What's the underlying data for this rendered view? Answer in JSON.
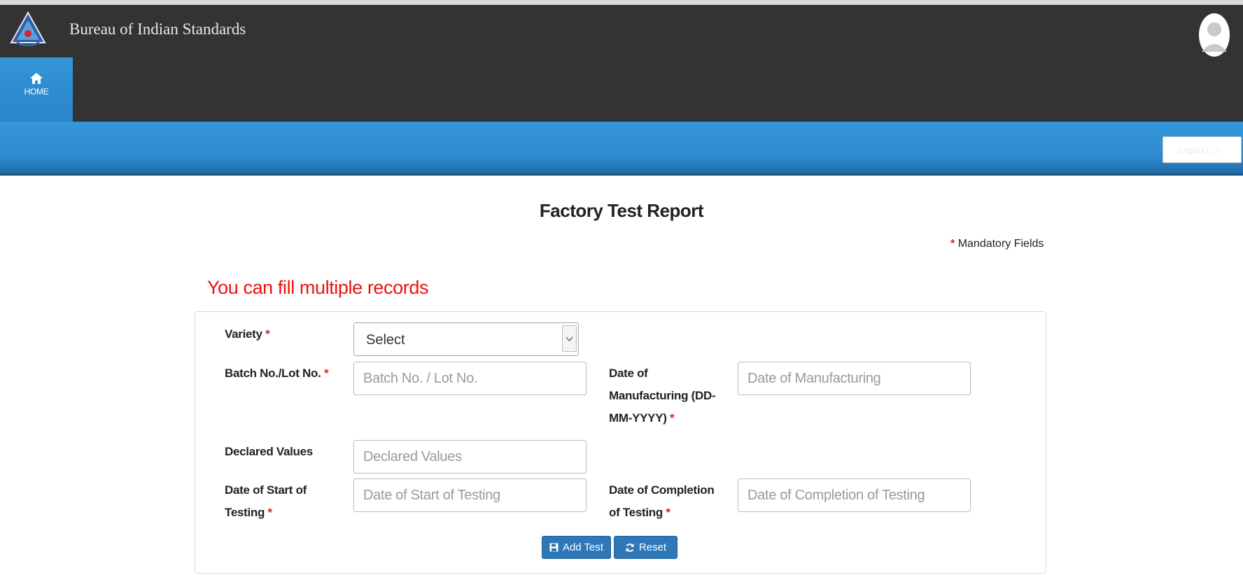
{
  "header": {
    "app_title": "Bureau of Indian Standards",
    "nav": {
      "home_label": "HOME"
    },
    "bar_input_text": "Logout (...)"
  },
  "page": {
    "title": "Factory Test Report",
    "mandatory_note": "Mandatory Fields",
    "fill_note": "You can fill multiple records"
  },
  "form": {
    "variety": {
      "label": "Variety",
      "value": "Select"
    },
    "batch_no": {
      "label": "Batch No./Lot No.",
      "placeholder": "Batch No. / Lot No."
    },
    "date_of_manufacturing": {
      "label_line1": "Date of",
      "label_line2": "Manufacturing (DD-",
      "label_line3": "MM-YYYY)",
      "placeholder": "Date of Manufacturing"
    },
    "declared_values": {
      "label": "Declared Values",
      "placeholder": "Declared Values"
    },
    "date_start_testing": {
      "label_line1": "Date of Start of",
      "label_line2": "Testing",
      "placeholder": "Date of Start of Testing"
    },
    "date_completion_testing": {
      "label_line1": "Date of Completion",
      "label_line2": "of Testing",
      "placeholder": "Date of Completion of Testing"
    },
    "required_marker": "*",
    "buttons": {
      "add_test": "Add Test",
      "reset": "Reset"
    }
  },
  "colors": {
    "header_bg": "#333333",
    "accent_blue": "#2e89cd",
    "required_red": "#e02020",
    "note_red": "#ee1111",
    "button_blue": "#2e78b8"
  },
  "icons": [
    "bis-logo",
    "user-avatar-icon",
    "home-icon",
    "save-icon",
    "refresh-icon",
    "chevron-down-icon"
  ]
}
